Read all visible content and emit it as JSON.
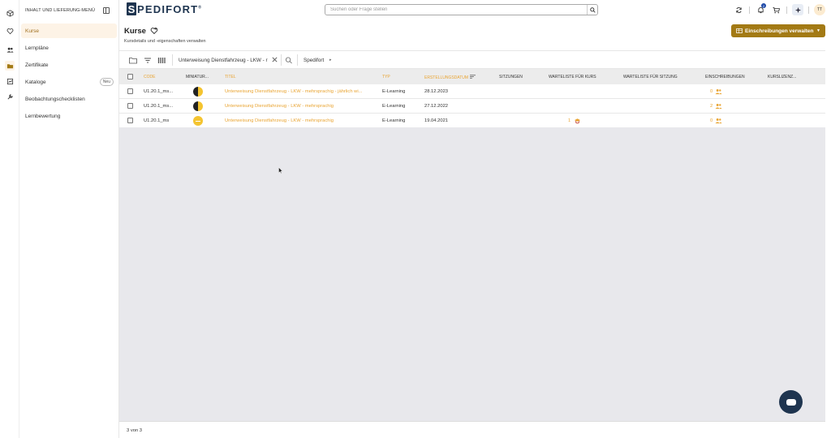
{
  "menu": {
    "header": "INHALT UND LIEFERUNG-MENÜ",
    "items": [
      {
        "label": "Kurse",
        "active": true
      },
      {
        "label": "Lernpläne"
      },
      {
        "label": "Zertifikate"
      },
      {
        "label": "Kataloge",
        "badge": "Neu"
      },
      {
        "label": "Beobachtungschecklisten"
      },
      {
        "label": "Lernbewertung"
      }
    ]
  },
  "brand": {
    "logo_letter": "S",
    "logo_text": "PEDIFORT",
    "trademark": "®"
  },
  "search": {
    "placeholder": "Suchen oder Frage stellen"
  },
  "topbar": {
    "notification_count": "2",
    "avatar_initials": "TT"
  },
  "page": {
    "title": "Kurse",
    "subtitle": "Kursdetails und -eigenschaften verwalten",
    "primary_action": "Einschreibungen verwalten"
  },
  "toolbar": {
    "filter_text": "Unterweisung Dienstfahrzeug - LKW - r",
    "organization": "Spedifort"
  },
  "table": {
    "columns": {
      "code": "CODE",
      "thumbnail": "MINIATUR...",
      "title": "TITEL",
      "type": "TYP",
      "created": "ERSTELLUNGSDATUM",
      "sessions": "SITZUNGEN",
      "waitlist_course": "WARTELISTE FÜR KURS",
      "waitlist_session": "WARTELISTE FÜR SITZUNG",
      "enrollments": "EINSCHREIBUNGEN",
      "licenses": "KURSLIZENZ..."
    },
    "rows": [
      {
        "code": "U1.20.1_ms...",
        "title": "Unterweisung Dienstfahrzeug - LKW - mehrsprachig - jährlich wi...",
        "type": "E-Learning",
        "created": "28.12.2023",
        "waitlist_course": "",
        "enrollments": "0",
        "thumb": "half"
      },
      {
        "code": "U1.20.1_ms...",
        "title": "Unterweisung Dienstfahrzeug - LKW - mehrsprachig",
        "type": "E-Learning",
        "created": "27.12.2022",
        "waitlist_course": "",
        "enrollments": "2",
        "thumb": "half"
      },
      {
        "code": "U1.20.1_ms",
        "title": "Unterweisung Dienstfahrzeug - LKW - mehrsprachig",
        "type": "E-Learning",
        "created": "19.04.2021",
        "waitlist_course": "1",
        "enrollments": "0",
        "thumb": "full"
      }
    ]
  },
  "footer": {
    "count": "3 von 3"
  },
  "colors": {
    "accent": "#a37a14",
    "link": "#e9a432",
    "brand": "#1f3550"
  }
}
